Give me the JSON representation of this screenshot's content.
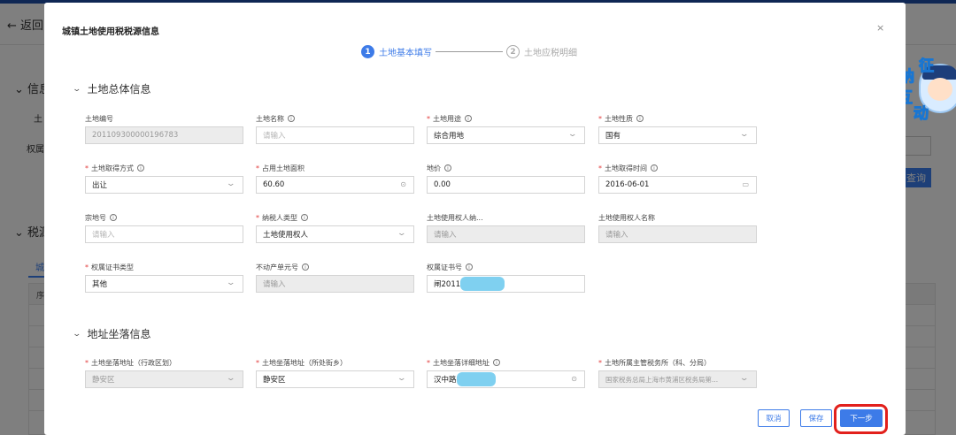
{
  "background": {
    "back_label": "返回",
    "info_label": "信息",
    "land_label": "土",
    "owner_label": "权属/",
    "tax_label": "税源",
    "tab_label": "城",
    "row_label": "序",
    "query_label": "查询"
  },
  "mascot": {
    "chars": [
      "纳",
      "征",
      "互",
      "动"
    ]
  },
  "modal": {
    "title": "城镇土地使用税税源信息",
    "close": "×",
    "steps": [
      {
        "num": "1",
        "label": "土地基本填写"
      },
      {
        "num": "2",
        "label": "土地应税明细"
      }
    ],
    "sections": {
      "general": "土地总体信息",
      "address": "地址坐落信息"
    },
    "fields": {
      "land_no": {
        "label": "土地编号",
        "value": "201109300000196783"
      },
      "land_name": {
        "label": "土地名称",
        "placeholder": "请输入"
      },
      "land_use": {
        "label": "土地用途",
        "value": "综合用地"
      },
      "land_nature": {
        "label": "土地性质",
        "value": "国有"
      },
      "acquire_method": {
        "label": "土地取得方式",
        "value": "出让"
      },
      "area": {
        "label": "占用土地面积",
        "value": "60.60"
      },
      "price": {
        "label": "地价",
        "value": "0.00"
      },
      "acquire_time": {
        "label": "土地取得时间",
        "value": "2016-06-01"
      },
      "parcel_no": {
        "label": "宗地号",
        "placeholder": "请输入"
      },
      "taxpayer_type": {
        "label": "纳税人类型",
        "value": "土地使用权人"
      },
      "user_taxid": {
        "label": "土地使用权人纳...",
        "placeholder": "请输入"
      },
      "user_name": {
        "label": "土地使用权人名称",
        "placeholder": "请输入"
      },
      "cert_type": {
        "label": "权属证书类型",
        "value": "其他"
      },
      "realty_unit": {
        "label": "不动产单元号",
        "placeholder": "请输入"
      },
      "cert_no": {
        "label": "权属证书号",
        "value": "闸2011"
      },
      "district": {
        "label": "土地坐落地址（行政区划）",
        "value": "静安区"
      },
      "street": {
        "label": "土地坐落地址（所处街乡）",
        "value": "静安区"
      },
      "detail_addr": {
        "label": "土地坐落详细地址",
        "value": "汉中路"
      },
      "tax_office": {
        "label": "土地所属主管税务所（科、分局）",
        "value": "国家税务总局上海市黄浦区税务局第..."
      }
    },
    "buttons": {
      "cancel": "取消",
      "save": "保存",
      "next": "下一步"
    }
  }
}
